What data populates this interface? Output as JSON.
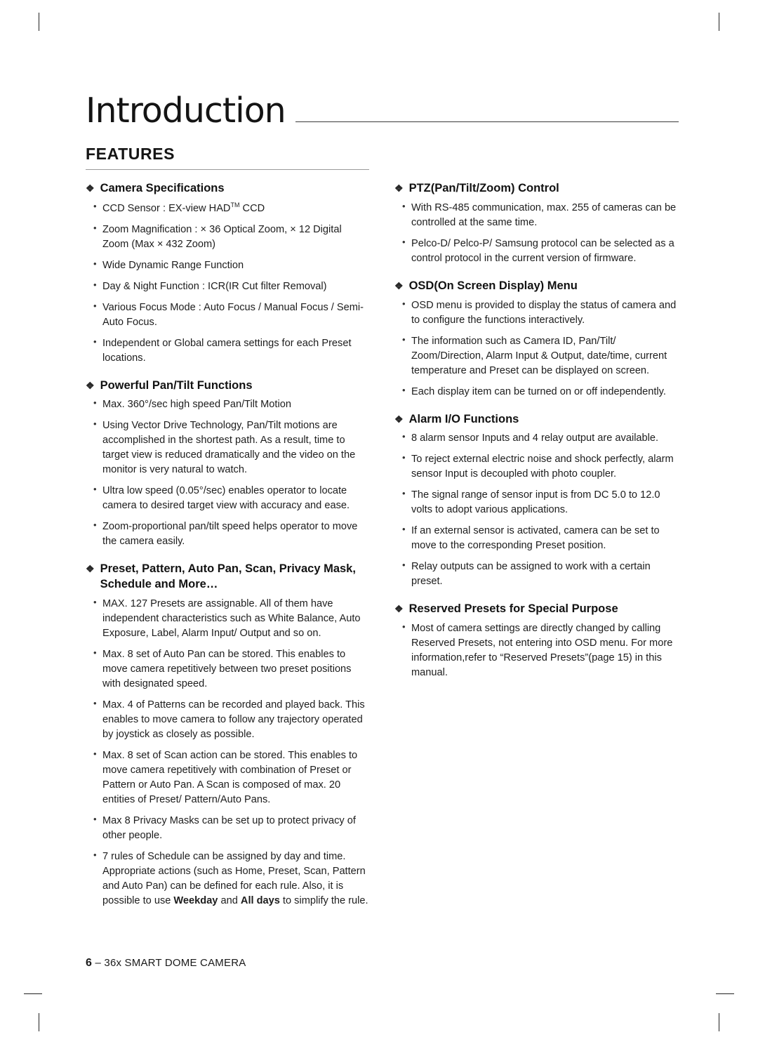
{
  "document": {
    "chapter_title": "Introduction",
    "section_title": "FEATURES",
    "footer": {
      "page_number": "6",
      "dash": "–",
      "product": "36x SMART DOME CAMERA"
    }
  },
  "left_column": [
    {
      "heading": "Camera Specifications",
      "bullets": [
        "CCD Sensor : EX-view HAD<sup class=\"tm\">TM</sup> CCD",
        "Zoom Magnification : × 36 Optical Zoom, × 12 Digital Zoom (Max × 432 Zoom)",
        "Wide Dynamic Range Function",
        "Day &amp; Night Function : ICR(IR Cut filter Removal)",
        "Various Focus Mode : Auto Focus / Manual Focus / Semi-Auto Focus.",
        "Independent or Global camera settings for each Preset locations."
      ]
    },
    {
      "heading": "Powerful Pan/Tilt Functions",
      "bullets": [
        "Max. 360°/sec high speed Pan/Tilt Motion",
        "Using Vector Drive Technology, Pan/Tilt motions are accomplished in the shortest path. As a result, time to target view is reduced dramatically and the video on the monitor is very natural to watch.",
        "Ultra low speed (0.05°/sec) enables operator to locate camera to desired target view with accuracy and ease.",
        "Zoom-proportional pan/tilt speed helps operator to move the camera easily."
      ]
    },
    {
      "heading": "Preset, Pattern, Auto Pan, Scan, Privacy Mask, Schedule and More…",
      "bullets": [
        "MAX. 127 Presets are assignable. All of them have independent characteristics such as White Balance, Auto Exposure, Label, Alarm Input/ Output and so on.",
        "Max. 8 set of Auto Pan can be stored. This enables to move camera repetitively between two preset positions with designated speed.",
        "Max. 4 of Patterns can be recorded and played back. This enables to move camera to follow any trajectory operated by joystick as closely as possible.",
        "Max. 8 set of Scan action can be stored. This enables to move camera repetitively with combination of Preset or Pattern or Auto Pan. A Scan is composed of max. 20 entities of Preset/ Pattern/Auto Pans.",
        "Max 8 Privacy Masks can be set up to protect privacy of other people.",
        "7 rules of Schedule can be assigned by day and time. Appropriate actions (such as Home, Preset, Scan, Pattern and Auto Pan) can be defined for each rule. Also, it is possible to use <b class=\"inl\">Weekday</b> and <b class=\"inl\">All days</b> to simplify the rule."
      ]
    }
  ],
  "right_column": [
    {
      "heading": "PTZ(Pan/Tilt/Zoom) Control",
      "bullets": [
        "With RS-485 communication, max. 255 of cameras can be controlled at the same time.",
        "Pelco-D/ Pelco-P/ Samsung protocol can be selected as a control protocol in the current version of firmware."
      ]
    },
    {
      "heading": "OSD(On Screen Display) Menu",
      "bullets": [
        "OSD menu is provided to display the status of camera and to configure the functions interactively.",
        "The information such as Camera ID, Pan/Tilt/ Zoom/Direction, Alarm Input &amp; Output, date/time, current temperature and Preset can be displayed on screen.",
        "Each display item can be turned on or off independently."
      ]
    },
    {
      "heading": "Alarm I/O Functions",
      "bullets": [
        "8 alarm sensor Inputs and 4 relay output are available.",
        "To reject external electric noise and shock perfectly, alarm sensor Input is decoupled with photo coupler.",
        "The signal range of sensor input is from DC 5.0 to 12.0 volts to adopt various applications.",
        "If an external sensor is activated, camera can be set to move to the corresponding Preset position.",
        "Relay outputs can be assigned to work with a certain preset."
      ]
    },
    {
      "heading": "Reserved Presets for Special Purpose",
      "bullets": [
        "Most of camera settings are directly changed by calling Reserved Presets, not entering into OSD menu. For more information,refer to “Reserved Presets”(page 15) in this manual."
      ]
    }
  ],
  "icons": {
    "diamond_bullet": "❖",
    "dot_bullet": "•"
  }
}
